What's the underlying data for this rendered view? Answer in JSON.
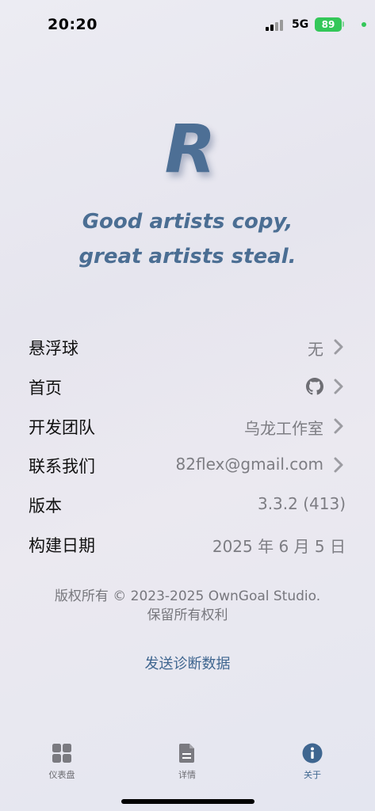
{
  "status": {
    "time": "20:20",
    "network": "5G",
    "battery": "89"
  },
  "logo": {
    "letter": "R"
  },
  "tagline": {
    "line1": "Good artists copy,",
    "line2": "great artists steal."
  },
  "rows": [
    {
      "label": "悬浮球",
      "value": "无"
    },
    {
      "label": "首页",
      "value": ""
    },
    {
      "label": "开发团队",
      "value": "乌龙工作室"
    },
    {
      "label": "联系我们",
      "value": "82flex@gmail.com"
    },
    {
      "label": "版本",
      "value": "3.3.2 (413)"
    },
    {
      "label": "构建日期",
      "value": "2025 年 6 月 5 日"
    }
  ],
  "copyright": {
    "line1": "版权所有 © 2023-2025 OwnGoal Studio.",
    "line2": "保留所有权利"
  },
  "send_diagnostics": "发送诊断数据",
  "tabs": [
    {
      "label": "仪表盘",
      "icon": "grid-icon"
    },
    {
      "label": "详情",
      "icon": "document-icon"
    },
    {
      "label": "关于",
      "icon": "info-icon"
    }
  ],
  "colors": {
    "accent": "#3f6690",
    "battery": "#34c759",
    "logo": "#4d6f95"
  }
}
